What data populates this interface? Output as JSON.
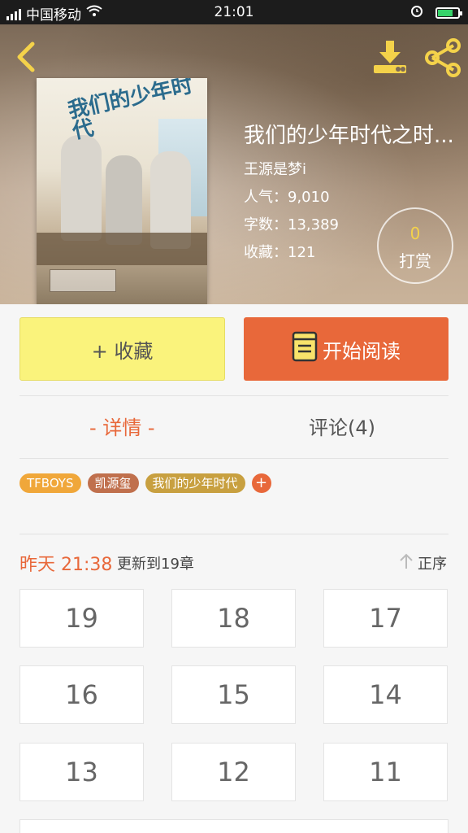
{
  "status": {
    "carrier": "中国移动",
    "time": "21:01",
    "net": "4G"
  },
  "book": {
    "title": "我们的少年时代之时...",
    "author": "王源是梦i",
    "popularity": "人气：9,010",
    "wordcount": "字数：13,389",
    "favorites": "收藏：121",
    "cover_title": "我们的少年时代"
  },
  "tip": {
    "count": "0",
    "label": "打赏"
  },
  "actions": {
    "fav_label": "+ 收藏",
    "read_label": "开始阅读"
  },
  "tabs": {
    "detail": "- 详情 -",
    "comments": "评论(4)"
  },
  "tags": [
    {
      "label": "TFBOYS",
      "color": "#f0a73a"
    },
    {
      "label": "凯源玺",
      "color": "#c0704d"
    },
    {
      "label": "我们的少年时代",
      "color": "#c8a040"
    }
  ],
  "tag_add": "+",
  "update": {
    "time": "昨天 21:38",
    "text": "更新到19章",
    "sort_label": "正序"
  },
  "chapters": [
    "19",
    "18",
    "17",
    "16",
    "15",
    "14",
    "13",
    "12",
    "11"
  ],
  "colors": {
    "accent": "#e8683a",
    "fav_bg": "#faf37c",
    "icon_yellow": "#f4d24a"
  }
}
